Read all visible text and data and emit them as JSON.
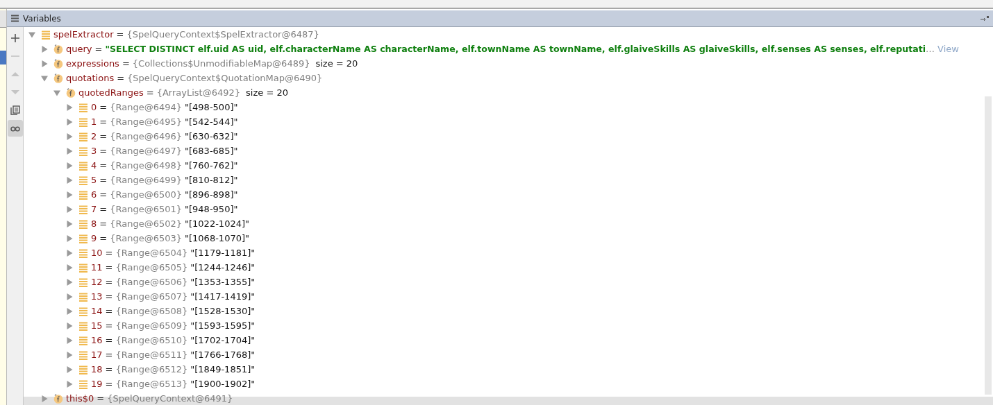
{
  "panel": {
    "title": "Variables"
  },
  "toolbar": [
    {
      "kind": "add",
      "disabled": false,
      "selected": false
    },
    {
      "kind": "remove",
      "disabled": true,
      "selected": false
    },
    {
      "kind": "up",
      "disabled": true,
      "selected": false
    },
    {
      "kind": "down",
      "disabled": true,
      "selected": false
    },
    {
      "kind": "copy",
      "disabled": false,
      "selected": false
    },
    {
      "kind": "watches",
      "disabled": false,
      "selected": true
    }
  ],
  "tree": [
    {
      "kind": "element",
      "name": "spelExtractor",
      "sep": "=",
      "ref": "{SpelQueryContext$SpelExtractor@6487}",
      "expanded": true,
      "children": [
        {
          "kind": "field",
          "name": "query",
          "sep": "=",
          "string_value": "\"SELECT DISTINCT elf.uid AS uid, elf.characterName AS characterName, elf.townName AS townName, elf.glaiveSkills AS glaiveSkills, elf.senses AS senses, elf.reputati",
          "truncation": "…",
          "view_link": "View",
          "expanded": false
        },
        {
          "kind": "field",
          "name": "expressions",
          "sep": "=",
          "ref": "{Collections$UnmodifiableMap@6489}",
          "size": "size = 20",
          "expanded": false
        },
        {
          "kind": "field",
          "name": "quotations",
          "sep": "=",
          "ref": "{SpelQueryContext$QuotationMap@6490}",
          "expanded": true,
          "children": [
            {
              "kind": "field",
              "name": "quotedRanges",
              "sep": "=",
              "ref": "{ArrayList@6492}",
              "size": "size = 20",
              "expanded": true,
              "children": [
                {
                  "kind": "element",
                  "name": "0",
                  "sep": "=",
                  "ref": "{Range@6494}",
                  "rendering": "\"[498-500]\"",
                  "expanded": false
                },
                {
                  "kind": "element",
                  "name": "1",
                  "sep": "=",
                  "ref": "{Range@6495}",
                  "rendering": "\"[542-544]\"",
                  "expanded": false
                },
                {
                  "kind": "element",
                  "name": "2",
                  "sep": "=",
                  "ref": "{Range@6496}",
                  "rendering": "\"[630-632]\"",
                  "expanded": false
                },
                {
                  "kind": "element",
                  "name": "3",
                  "sep": "=",
                  "ref": "{Range@6497}",
                  "rendering": "\"[683-685]\"",
                  "expanded": false
                },
                {
                  "kind": "element",
                  "name": "4",
                  "sep": "=",
                  "ref": "{Range@6498}",
                  "rendering": "\"[760-762]\"",
                  "expanded": false
                },
                {
                  "kind": "element",
                  "name": "5",
                  "sep": "=",
                  "ref": "{Range@6499}",
                  "rendering": "\"[810-812]\"",
                  "expanded": false
                },
                {
                  "kind": "element",
                  "name": "6",
                  "sep": "=",
                  "ref": "{Range@6500}",
                  "rendering": "\"[896-898]\"",
                  "expanded": false
                },
                {
                  "kind": "element",
                  "name": "7",
                  "sep": "=",
                  "ref": "{Range@6501}",
                  "rendering": "\"[948-950]\"",
                  "expanded": false
                },
                {
                  "kind": "element",
                  "name": "8",
                  "sep": "=",
                  "ref": "{Range@6502}",
                  "rendering": "\"[1022-1024]\"",
                  "expanded": false
                },
                {
                  "kind": "element",
                  "name": "9",
                  "sep": "=",
                  "ref": "{Range@6503}",
                  "rendering": "\"[1068-1070]\"",
                  "expanded": false
                },
                {
                  "kind": "element",
                  "name": "10",
                  "sep": "=",
                  "ref": "{Range@6504}",
                  "rendering": "\"[1179-1181]\"",
                  "expanded": false
                },
                {
                  "kind": "element",
                  "name": "11",
                  "sep": "=",
                  "ref": "{Range@6505}",
                  "rendering": "\"[1244-1246]\"",
                  "expanded": false
                },
                {
                  "kind": "element",
                  "name": "12",
                  "sep": "=",
                  "ref": "{Range@6506}",
                  "rendering": "\"[1353-1355]\"",
                  "expanded": false
                },
                {
                  "kind": "element",
                  "name": "13",
                  "sep": "=",
                  "ref": "{Range@6507}",
                  "rendering": "\"[1417-1419]\"",
                  "expanded": false
                },
                {
                  "kind": "element",
                  "name": "14",
                  "sep": "=",
                  "ref": "{Range@6508}",
                  "rendering": "\"[1528-1530]\"",
                  "expanded": false
                },
                {
                  "kind": "element",
                  "name": "15",
                  "sep": "=",
                  "ref": "{Range@6509}",
                  "rendering": "\"[1593-1595]\"",
                  "expanded": false
                },
                {
                  "kind": "element",
                  "name": "16",
                  "sep": "=",
                  "ref": "{Range@6510}",
                  "rendering": "\"[1702-1704]\"",
                  "expanded": false
                },
                {
                  "kind": "element",
                  "name": "17",
                  "sep": "=",
                  "ref": "{Range@6511}",
                  "rendering": "\"[1766-1768]\"",
                  "expanded": false
                },
                {
                  "kind": "element",
                  "name": "18",
                  "sep": "=",
                  "ref": "{Range@6512}",
                  "rendering": "\"[1849-1851]\"",
                  "expanded": false
                },
                {
                  "kind": "element",
                  "name": "19",
                  "sep": "=",
                  "ref": "{Range@6513}",
                  "rendering": "\"[1900-1902]\"",
                  "expanded": false
                }
              ]
            }
          ]
        },
        {
          "kind": "field",
          "name": "this$0",
          "sep": "=",
          "ref": "{SpelQueryContext@6491}",
          "expanded": false
        }
      ]
    }
  ]
}
